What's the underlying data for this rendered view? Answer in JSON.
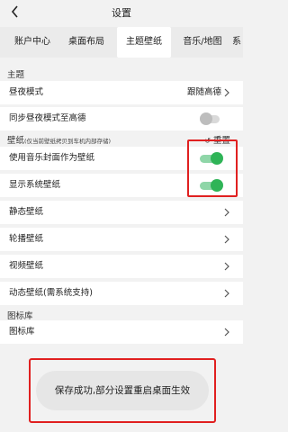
{
  "header": {
    "title": "设置"
  },
  "tabs": [
    {
      "label": "账户中心"
    },
    {
      "label": "桌面布局"
    },
    {
      "label": "主题壁纸"
    },
    {
      "label": "音乐/地图"
    },
    {
      "label": "系"
    }
  ],
  "sections": {
    "theme": "主题",
    "wallpaper_title": "壁纸",
    "wallpaper_note": "(仅当前壁纸拷贝到车机内部存储)",
    "wallpaper_reset": "重置",
    "icons": "图标库"
  },
  "rows": {
    "day_night": {
      "label": "昼夜模式",
      "value": "跟随高德"
    },
    "sync_amap": {
      "label": "同步昼夜模式至高德",
      "on": false
    },
    "music_cover": {
      "label": "使用音乐封面作为壁纸",
      "on": true
    },
    "system_wallpaper": {
      "label": "显示系统壁纸",
      "on": true
    },
    "static_wallpaper": {
      "label": "静态壁纸"
    },
    "carousel_wallpaper": {
      "label": "轮播壁纸"
    },
    "video_wallpaper": {
      "label": "视频壁纸"
    },
    "dynamic_wallpaper": {
      "label": "动态壁纸(需系统支持)"
    },
    "icon_library": {
      "label": "图标库"
    }
  },
  "toast": {
    "message": "保存成功,部分设置重启桌面生效"
  },
  "colors": {
    "toggle_on": "#2fb457",
    "toggle_off": "#bdbdbd",
    "highlight": "#e02020"
  }
}
